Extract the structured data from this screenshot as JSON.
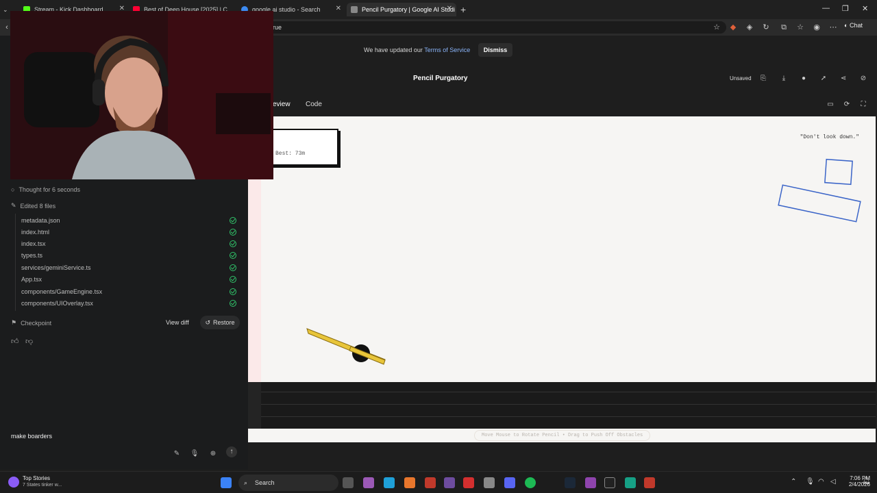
{
  "browser": {
    "tabs": [
      {
        "label": "Stream - Kick Dashboard",
        "icon": "kick-icon",
        "color": "#53fc18"
      },
      {
        "label": "Best of Deep House [2025] | C",
        "icon": "youtube-icon",
        "color": "#ff0033"
      },
      {
        "label": "google ai studio - Search",
        "icon": "bing-icon",
        "color": "#3c8af0"
      },
      {
        "label": "Pencil Purgatory | Google AI Studi",
        "icon": "aistudio-icon",
        "color": "#aaaaaa",
        "active": true
      }
    ],
    "address": "rue",
    "chat_label": "Chat"
  },
  "chat": {
    "thought": "Thought for 6 seconds",
    "edited": "Edited 8 files",
    "files": [
      "metadata.json",
      "index.html",
      "index.tsx",
      "types.ts",
      "services/geminiService.ts",
      "App.tsx",
      "components/GameEngine.tsx",
      "components/UIOverlay.tsx"
    ],
    "checkpoint": "Checkpoint",
    "view_diff": "View diff",
    "restore": "Restore",
    "prompt_value": "make boarders "
  },
  "banner": {
    "text": "We have updated our ",
    "link": "Terms of Service",
    "dismiss": "Dismiss"
  },
  "header": {
    "title": "Pencil Purgatory",
    "status": "Unsaved"
  },
  "view_tabs": {
    "preview": "eview",
    "code": "Code"
  },
  "game": {
    "best": "Best: 73m",
    "quote": "\"Don't look down.\"",
    "instructions": "Move Mouse to Rotate Pencil • Drag to Push Off Obstacles",
    "pencil_color": "#e8c53a",
    "obstacle_color": "#3a64c8"
  },
  "taskbar": {
    "news_title": "Top Stories",
    "news_sub": "7 States tinker w...",
    "search": "Search",
    "time": "7:06 PM",
    "date": "2/4/2026"
  }
}
